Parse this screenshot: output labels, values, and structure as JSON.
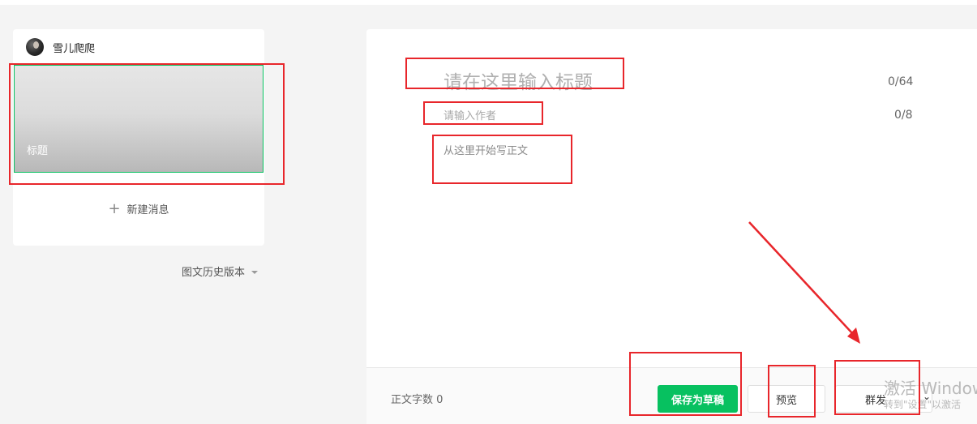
{
  "account": {
    "name": "雪儿爬爬"
  },
  "article_card": {
    "cover_title": "标题",
    "new_message_label": "新建消息"
  },
  "history": {
    "label": "图文历史版本"
  },
  "editor": {
    "title_placeholder": "请在这里输入标题",
    "title_count": "0/64",
    "author_placeholder": "请输入作者",
    "author_count": "0/8",
    "body_placeholder": "从这里开始写正文"
  },
  "footer": {
    "word_count_label": "正文字数",
    "word_count": "0",
    "save_label": "保存为草稿",
    "preview_label": "预览",
    "publish_label": "群发"
  },
  "watermark": {
    "line1": "激活 Windows",
    "line2": "转到\"设置\"以激活"
  },
  "colors": {
    "accent": "#07c160",
    "annotation": "#e8262b"
  }
}
